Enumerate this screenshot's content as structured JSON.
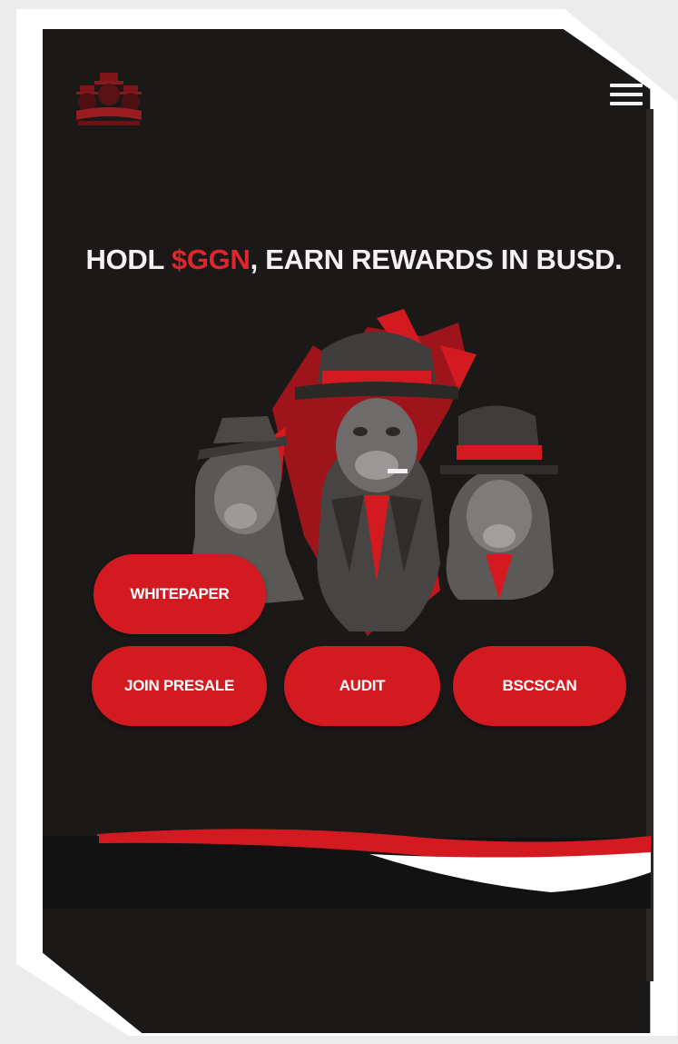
{
  "header": {
    "logo_icon": "gorilla-gang-logo-icon",
    "menu_icon": "hamburger-menu-icon"
  },
  "hero": {
    "headline_prefix": "HODL ",
    "headline_token": "$GGN",
    "headline_suffix": ", EARN REWARDS IN BUSD.",
    "illustration": "three-gangster-gorillas-illustration"
  },
  "buttons": {
    "whitepaper": "WHITEPAPER",
    "join_presale": "JOIN PRESALE",
    "audit": "AUDIT",
    "bscscan": "BSCSCAN"
  },
  "colors": {
    "background": "#1b1918",
    "accent": "#d41a21",
    "text": "#f3f1f1"
  }
}
